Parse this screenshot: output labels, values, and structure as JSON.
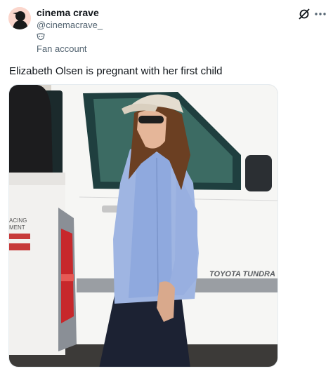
{
  "author": {
    "display_name": "cinema crave",
    "handle": "@cinemacrave_",
    "affiliation_label": "Fan account",
    "affiliation_icon": "mask-icon",
    "avatar_icon": "avatar-icon"
  },
  "actions": {
    "grok_icon": "grok-icon",
    "more_icon": "more-icon"
  },
  "tweet": {
    "text": "Elizabeth Olsen is pregnant with her first child"
  },
  "media": {
    "truck_left_text": [
      "ACING",
      "MENT"
    ],
    "truck_brand_text": "TOYOTA TUNDRA"
  },
  "colors": {
    "text_primary": "#0f1419",
    "text_secondary": "#536471",
    "shirt_blue": "#8fa9de"
  }
}
